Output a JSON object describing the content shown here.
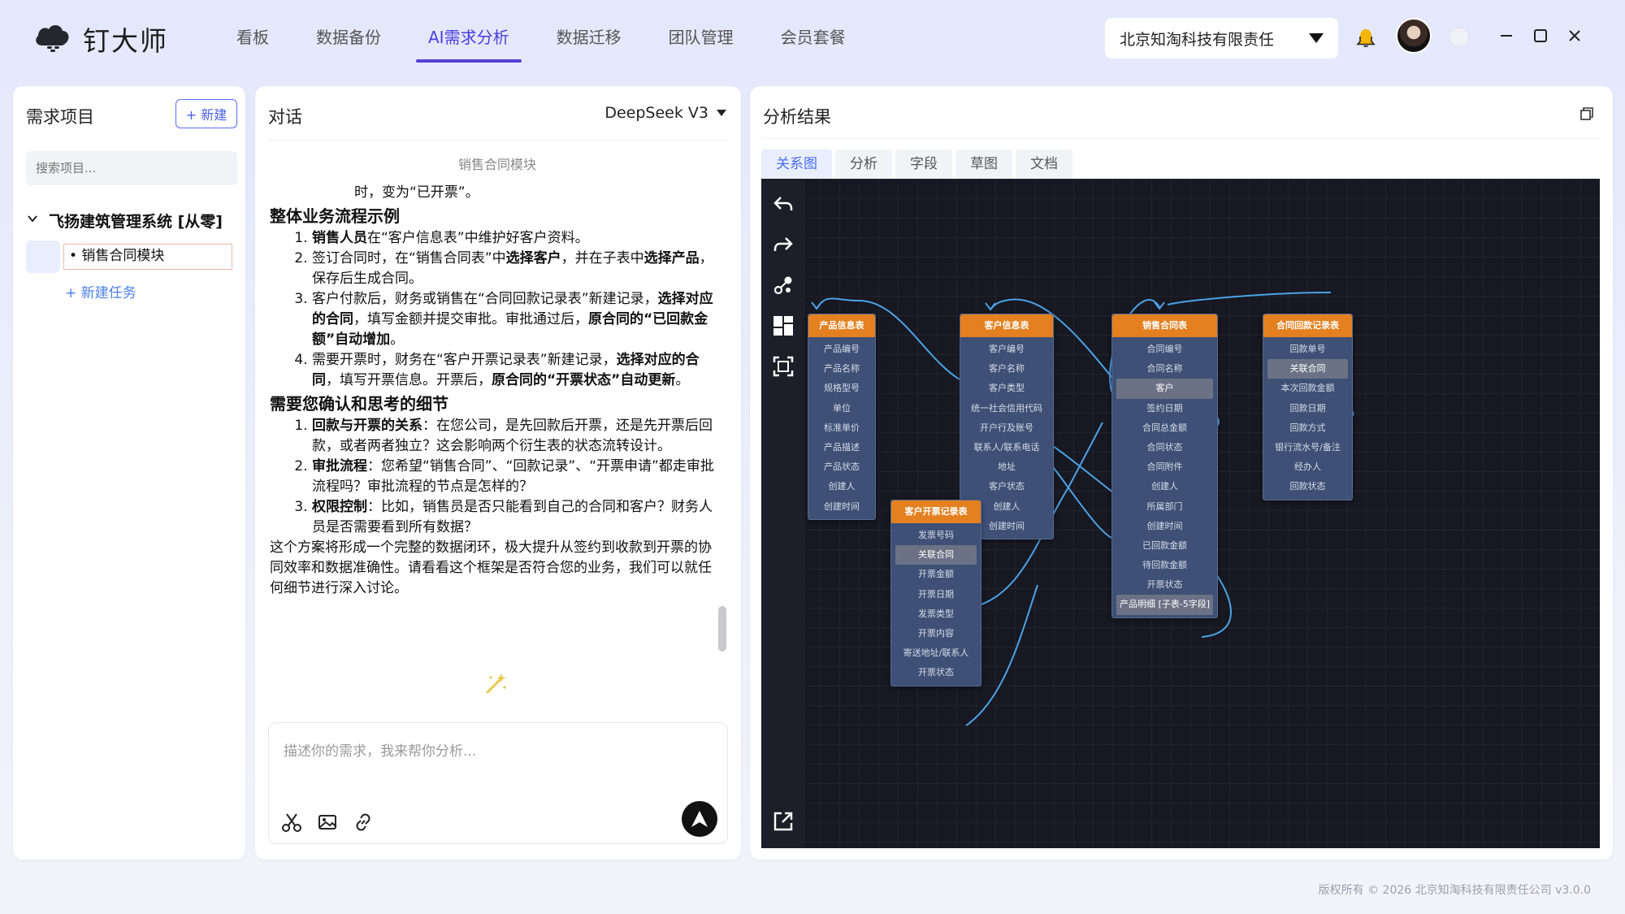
{
  "app": {
    "name": "钉大师"
  },
  "nav": [
    {
      "label": "看板",
      "active": false
    },
    {
      "label": "数据备份",
      "active": false
    },
    {
      "label": "AI需求分析",
      "active": true
    },
    {
      "label": "数据迁移",
      "active": false
    },
    {
      "label": "团队管理",
      "active": false
    },
    {
      "label": "会员套餐",
      "active": false
    }
  ],
  "header": {
    "company": "北京知淘科技有限责任"
  },
  "left": {
    "title": "需求项目",
    "new_button": "+ 新建",
    "search_placeholder": "搜索项目...",
    "project": "飞扬建筑管理系统 [从零]",
    "task": "• 销售合同模块",
    "new_task": "+ 新建任务"
  },
  "chat": {
    "title": "对话",
    "model": "DeepSeek V3",
    "context_title": "销售合同模块",
    "lead_line": "时，变为“已开票”。",
    "section1": {
      "heading": "整体业务流程示例",
      "items": [
        [
          {
            "t": "销售人员",
            "b": true
          },
          {
            "t": "在“客户信息表”中维护好客户资料。"
          }
        ],
        [
          {
            "t": "签订合同时，在“销售合同表”中"
          },
          {
            "t": "选择客户",
            "b": true
          },
          {
            "t": "，并在子表中"
          },
          {
            "t": "选择产品",
            "b": true
          },
          {
            "t": "，保存后生成合同。"
          }
        ],
        [
          {
            "t": "客户付款后，财务或销售在“合同回款记录表”新建记录，"
          },
          {
            "t": "选择对应的合同",
            "b": true
          },
          {
            "t": "，填写金额并提交审批。审批通过后，"
          },
          {
            "t": "原合同的“已回款金额”自动增加",
            "b": true
          },
          {
            "t": "。"
          }
        ],
        [
          {
            "t": "需要开票时，财务在“客户开票记录表”新建记录，"
          },
          {
            "t": "选择对应的合同",
            "b": true
          },
          {
            "t": "，填写开票信息。开票后，"
          },
          {
            "t": "原合同的“开票状态”自动更新",
            "b": true
          },
          {
            "t": "。"
          }
        ]
      ]
    },
    "section2": {
      "heading": "需要您确认和思考的细节",
      "items": [
        [
          {
            "t": "回款与开票的关系",
            "b": true
          },
          {
            "t": "：在您公司，是先回款后开票，还是先开票后回款，或者两者独立？这会影响两个衍生表的状态流转设计。"
          }
        ],
        [
          {
            "t": "审批流程",
            "b": true
          },
          {
            "t": "：您希望“销售合同”、“回款记录”、“开票申请”都走审批流程吗？审批流程的节点是怎样的？"
          }
        ],
        [
          {
            "t": "权限控制",
            "b": true
          },
          {
            "t": "：比如，销售员是否只能看到自己的合同和客户？财务人员是否需要看到所有数据？"
          }
        ]
      ]
    },
    "closing": "这个方案将形成一个完整的数据闭环，极大提升从签约到收款到开票的协同效率和数据准确性。请看看这个框架是否符合您的业务，我们可以就任何细节进行深入讨论。",
    "input_placeholder": "描述你的需求，我来帮你分析..."
  },
  "analysis": {
    "title": "分析结果",
    "tabs": [
      {
        "label": "关系图",
        "active": true
      },
      {
        "label": "分析",
        "active": false
      },
      {
        "label": "字段",
        "active": false
      },
      {
        "label": "草图",
        "active": false
      },
      {
        "label": "文档",
        "active": false
      }
    ],
    "tables": [
      {
        "id": "product",
        "name": "产品信息表",
        "fields": [
          "产品编号",
          "产品名称",
          "规格型号",
          "单位",
          "标准单价",
          "产品描述",
          "产品状态",
          "创建人",
          "创建时间"
        ],
        "highlight": []
      },
      {
        "id": "customer",
        "name": "客户信息表",
        "fields": [
          "客户编号",
          "客户名称",
          "客户类型",
          "统一社会信用代码",
          "开户行及账号",
          "联系人/联系电话",
          "地址",
          "客户状态",
          "创建人",
          "创建时间"
        ],
        "highlight": []
      },
      {
        "id": "contract",
        "name": "销售合同表",
        "fields": [
          "合同编号",
          "合同名称",
          "客户",
          "签约日期",
          "合同总金额",
          "合同状态",
          "合同附件",
          "创建人",
          "所属部门",
          "创建时间",
          "已回款金额",
          "待回款金额",
          "开票状态",
          "产品明细 [子表-5字段]"
        ],
        "highlight": [
          2,
          13
        ]
      },
      {
        "id": "payment",
        "name": "合同回款记录表",
        "fields": [
          "回款单号",
          "关联合同",
          "本次回款金额",
          "回款日期",
          "回款方式",
          "银行流水号/备注",
          "经办人",
          "回款状态"
        ],
        "highlight": [
          1
        ]
      },
      {
        "id": "invoice",
        "name": "客户开票记录表",
        "fields": [
          "发票号码",
          "关联合同",
          "开票金额",
          "开票日期",
          "发票类型",
          "开票内容",
          "寄送地址/联系人",
          "开票状态"
        ],
        "highlight": [
          1
        ]
      }
    ]
  },
  "footer": {
    "copyright": "版权所有 © 2026 北京知淘科技有限责任公司 v3.0.0"
  },
  "colors": {
    "accent": "#4b3fe0",
    "er_header": "#e4801f",
    "er_body": "#3e5075",
    "edge": "#4aa3e8",
    "canvas": "#171821"
  }
}
